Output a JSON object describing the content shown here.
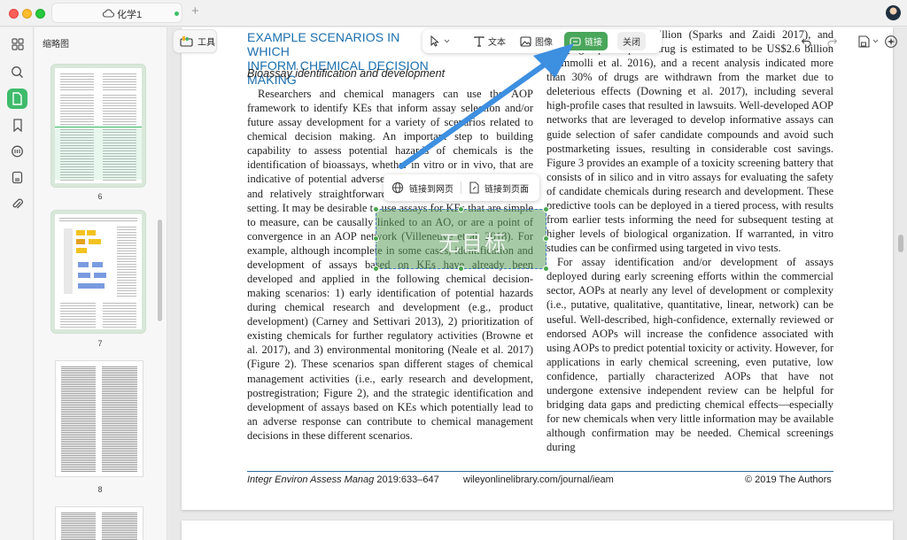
{
  "window": {
    "tab_title": "化学1",
    "add_tab_glyph": "+"
  },
  "rail": {
    "icons": [
      "grid-icon",
      "search-icon",
      "page-icon",
      "bookmark-icon",
      "comment-icon",
      "stamp-icon",
      "attachment-icon"
    ],
    "active": "page-icon"
  },
  "thumbnails": {
    "title": "缩略图",
    "pages": [
      {
        "number": "6"
      },
      {
        "number": "7"
      },
      {
        "number": "8"
      }
    ]
  },
  "toolbar": {
    "tool_label": "工具",
    "text_label": "文本",
    "image_label": "图像",
    "link_label": "链接",
    "close_label": "关闭"
  },
  "popup": {
    "link_web": "链接到网页",
    "link_page": "链接到页面"
  },
  "selection": {
    "label": "无目标"
  },
  "document": {
    "heading_line1": "EXAMPLE SCENARIOS IN WHICH",
    "heading_line2": "INFORM CHEMICAL DECISION MAKING",
    "subheading": "Bioassay identification and development",
    "left_paragraph": "Researchers and chemical managers can use the AOP framework to identify KEs that inform assay selection and/or future assay development for a variety of scenarios related to chemical decision making. An important step to building capability to assess potential hazards of chemicals is the identification of bioassays, whether in vitro or in vivo, that are indicative of potential adverse outcomes and are cost-effective and relatively straightforward to conduct in the laboratory setting. It may be desirable to use assays for KEs that are simple to measure, can be causally linked to an AO, or are a point of convergence in an AOP network (Villeneuve et al. 2018). For example, although incomplete in some cases, identification and development of assays based on KEs have already been developed and applied in the following chemical decision-making scenarios: 1) early identification of potential hazards during chemical research and development (e.g., product development) (Carney and Settivari 2013), 2) prioritization of existing chemicals for further regulatory activities (Browne et al. 2017), and 3) environmental monitoring (Neale et al. 2017) (Figure 2). These scenarios span different stages of chemical management activities (i.e., early research and development, postregistration; Figure 2), and the strategic identification and development of assays based on KEs which potentially lead to an adverse response can contribute to chemical management decisions in these different scenarios.",
    "right_top": "mated to be US$2.6 billion (Sparks and Zaidi 2017), and bringing a prescription drug is estimated to be US$2.6 billion (Pammolli et al. 2016), and a recent analysis indicated more than 30% of drugs are withdrawn from the market due to deleterious effects (Downing et al. 2017), including several high-profile cases that resulted in lawsuits. Well-developed AOP networks that are leveraged to develop informative assays can guide selection of safer candidate compounds and avoid such postmarketing issues, resulting in considerable cost savings. Figure 3 provides an example of a toxicity screening battery that consists of in silico and in vitro assays for evaluating the safety of candidate chemicals during research and development. These predictive tools can be deployed in a tiered process, with results from earlier tests informing the need for subsequent testing at higher levels of biological organization. If warranted, in vitro studies can be confirmed using targeted in vivo tests.",
    "right_paragraph": "For assay identification and/or development of assays deployed during early screening efforts within the commercial sector, AOPs at nearly any level of development or complexity (i.e., putative, qualitative, quantitative, linear, network) can be useful. Well-described, high-confidence, externally reviewed or endorsed AOPs will increase the confidence associated with using AOPs to predict potential toxicity or activity. However, for applications in early chemical screening, even putative, low confidence, partially characterized AOPs that have not undergone extensive independent review can be helpful for bridging data gaps and predicting chemical effects—especially for new chemicals when very little information may be available although confirmation may be needed. Chemical screenings during",
    "footer_journal": "Integr Environ Assess Manag",
    "footer_pages": " 2019:633–647",
    "footer_url": "wileyonlinelibrary.com/journal/ieam",
    "footer_copyright": "© 2019 The Authors"
  },
  "colors": {
    "accent": "#3ebb6b",
    "heading": "#1b6fae",
    "selection": "#5c9e5c",
    "arrow": "#3d8fe0"
  }
}
